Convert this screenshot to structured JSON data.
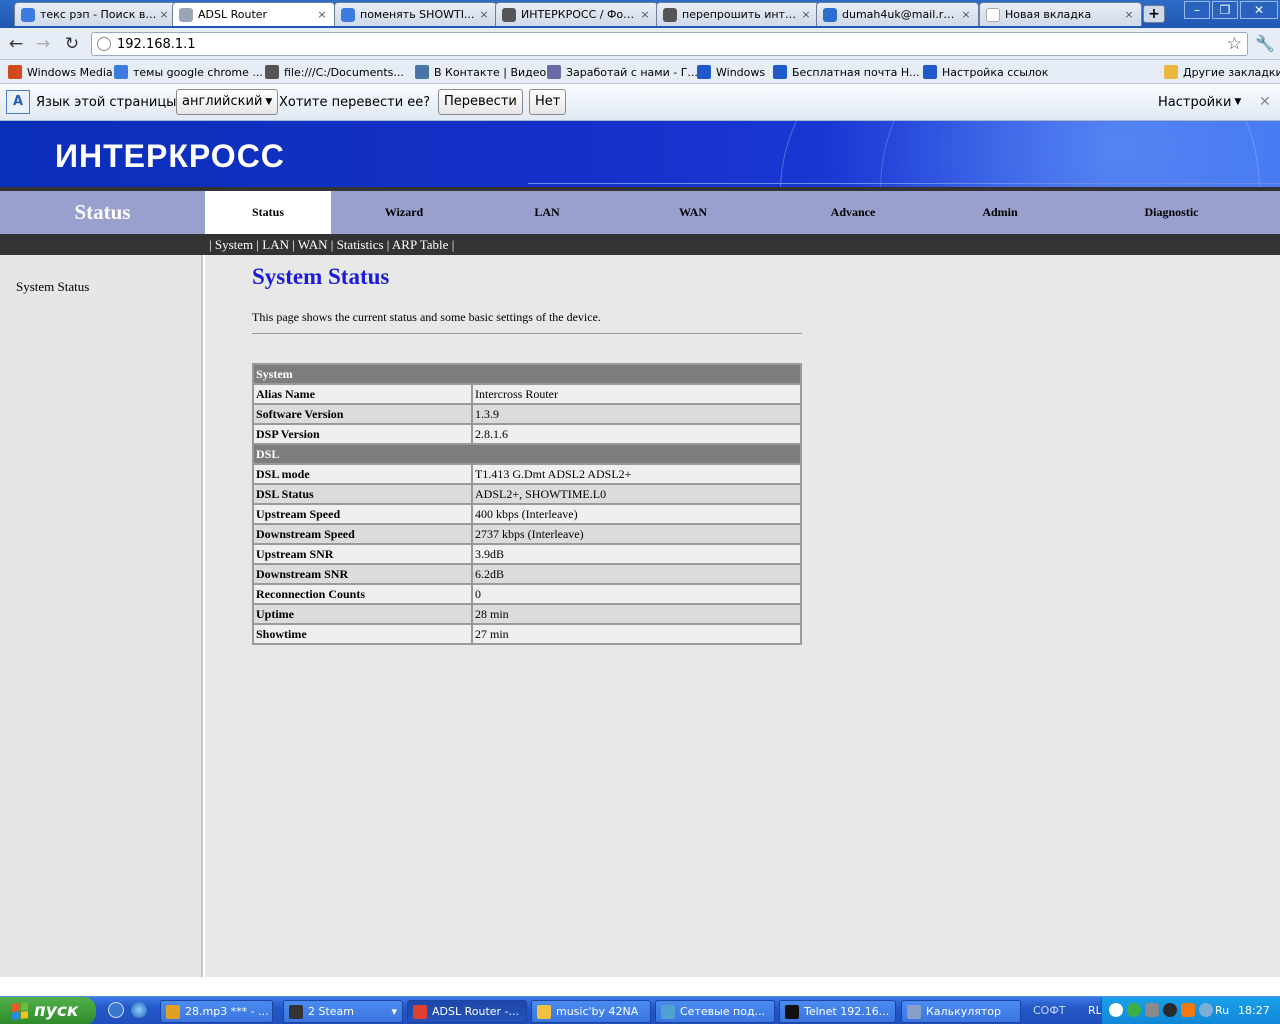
{
  "browser": {
    "tabs": [
      {
        "label": "текс рэп - Поиск в ...",
        "icon": "google-icon",
        "color": "#3a7be0"
      },
      {
        "label": "ADSL Router",
        "icon": "page-icon",
        "color": "#9aa6b8"
      },
      {
        "label": "поменять SHOWTI...",
        "icon": "google-icon",
        "color": "#3a7be0"
      },
      {
        "label": "ИНТЕРКРОСС / Фор...",
        "icon": "router-icon",
        "color": "#555555"
      },
      {
        "label": "перепрошить инте...",
        "icon": "router-icon",
        "color": "#555555"
      },
      {
        "label": "dumah4uk@mail.ru: ...",
        "icon": "mail-icon",
        "color": "#2a6fd0"
      },
      {
        "label": "Новая вкладка",
        "icon": "newtab-icon",
        "color": "#ffffff"
      }
    ],
    "url": "192.168.1.1",
    "bookmarks": [
      {
        "label": "Windows Media",
        "icon": "windows-icon",
        "color": "#d04a1c"
      },
      {
        "label": "темы google chrome ...",
        "icon": "google-icon",
        "color": "#3a7be0"
      },
      {
        "label": "file:///C:/Documents...",
        "icon": "file-icon",
        "color": "#555555"
      },
      {
        "label": "В Контакте | Видео",
        "icon": "vk-icon",
        "color": "#4a76a8"
      },
      {
        "label": "Заработай с нами - Г...",
        "icon": "globe-icon",
        "color": "#6a6aa8"
      },
      {
        "label": "Windows",
        "icon": "mail-m-icon",
        "color": "#1e58c9"
      },
      {
        "label": "Бесплатная почта Н...",
        "icon": "mail-m-icon",
        "color": "#1e58c9"
      },
      {
        "label": "Настройка ссылок",
        "icon": "mail-m-icon",
        "color": "#1e58c9"
      }
    ],
    "other_bookmarks": "Другие закладки"
  },
  "translate_bar": {
    "prompt": "Язык этой страницы",
    "language": "английский",
    "question": "Хотите перевести ее?",
    "translate_button": "Перевести",
    "no_button": "Нет",
    "settings": "Настройки"
  },
  "router": {
    "logo": "ИНТЕРКРОСС",
    "section_title": "Status",
    "nav": [
      "Status",
      "Wizard",
      "LAN",
      "WAN",
      "Advance",
      "Admin",
      "Diagnostic"
    ],
    "active_nav": "Status",
    "subnav": [
      "System",
      "LAN",
      "WAN",
      "Statistics",
      "ARP Table"
    ],
    "sidebar_item": "System Status",
    "page_title": "System Status",
    "page_desc": "This page shows the current status and some basic settings of the device.",
    "table": [
      {
        "section": "System"
      },
      {
        "label": "Alias Name",
        "value": "Intercross Router"
      },
      {
        "label": "Software Version",
        "value": "1.3.9"
      },
      {
        "label": "DSP Version",
        "value": "2.8.1.6"
      },
      {
        "section": "DSL"
      },
      {
        "label": "DSL mode",
        "value": "T1.413 G.Dmt ADSL2 ADSL2+"
      },
      {
        "label": "DSL Status",
        "value": "ADSL2+, SHOWTIME.L0"
      },
      {
        "label": "Upstream Speed",
        "value": "400 kbps  (Interleave)"
      },
      {
        "label": "Downstream Speed",
        "value": "2737 kbps  (Interleave)"
      },
      {
        "label": "Upstream SNR",
        "value": "3.9dB"
      },
      {
        "label": "Downstream SNR",
        "value": "6.2dB"
      },
      {
        "label": "Reconnection Counts",
        "value": "0"
      },
      {
        "label": "Uptime",
        "value": "28 min"
      },
      {
        "label": "Showtime",
        "value": "27 min"
      }
    ]
  },
  "taskbar": {
    "start": "пуск",
    "tasks": [
      {
        "label": "28.mp3 *** - ...",
        "icon": "aimp-icon",
        "color": "#e0a020"
      },
      {
        "label": "2 Steam",
        "icon": "steam-icon",
        "color": "#333333"
      },
      {
        "label": "ADSL Router -...",
        "icon": "chrome-icon",
        "color": "#e04030"
      },
      {
        "label": "music'by 42NA",
        "icon": "folder-icon",
        "color": "#f0c040"
      },
      {
        "label": "Сетевые под...",
        "icon": "network-icon",
        "color": "#50a0d0"
      },
      {
        "label": "Telnet 192.16...",
        "icon": "console-icon",
        "color": "#111111"
      },
      {
        "label": "Калькулятор",
        "icon": "calculator-icon",
        "color": "#8aa0c8"
      }
    ],
    "soft_label": "СОФТ",
    "lang": "RL",
    "tray_lang": "Ru",
    "clock": "18:27"
  }
}
